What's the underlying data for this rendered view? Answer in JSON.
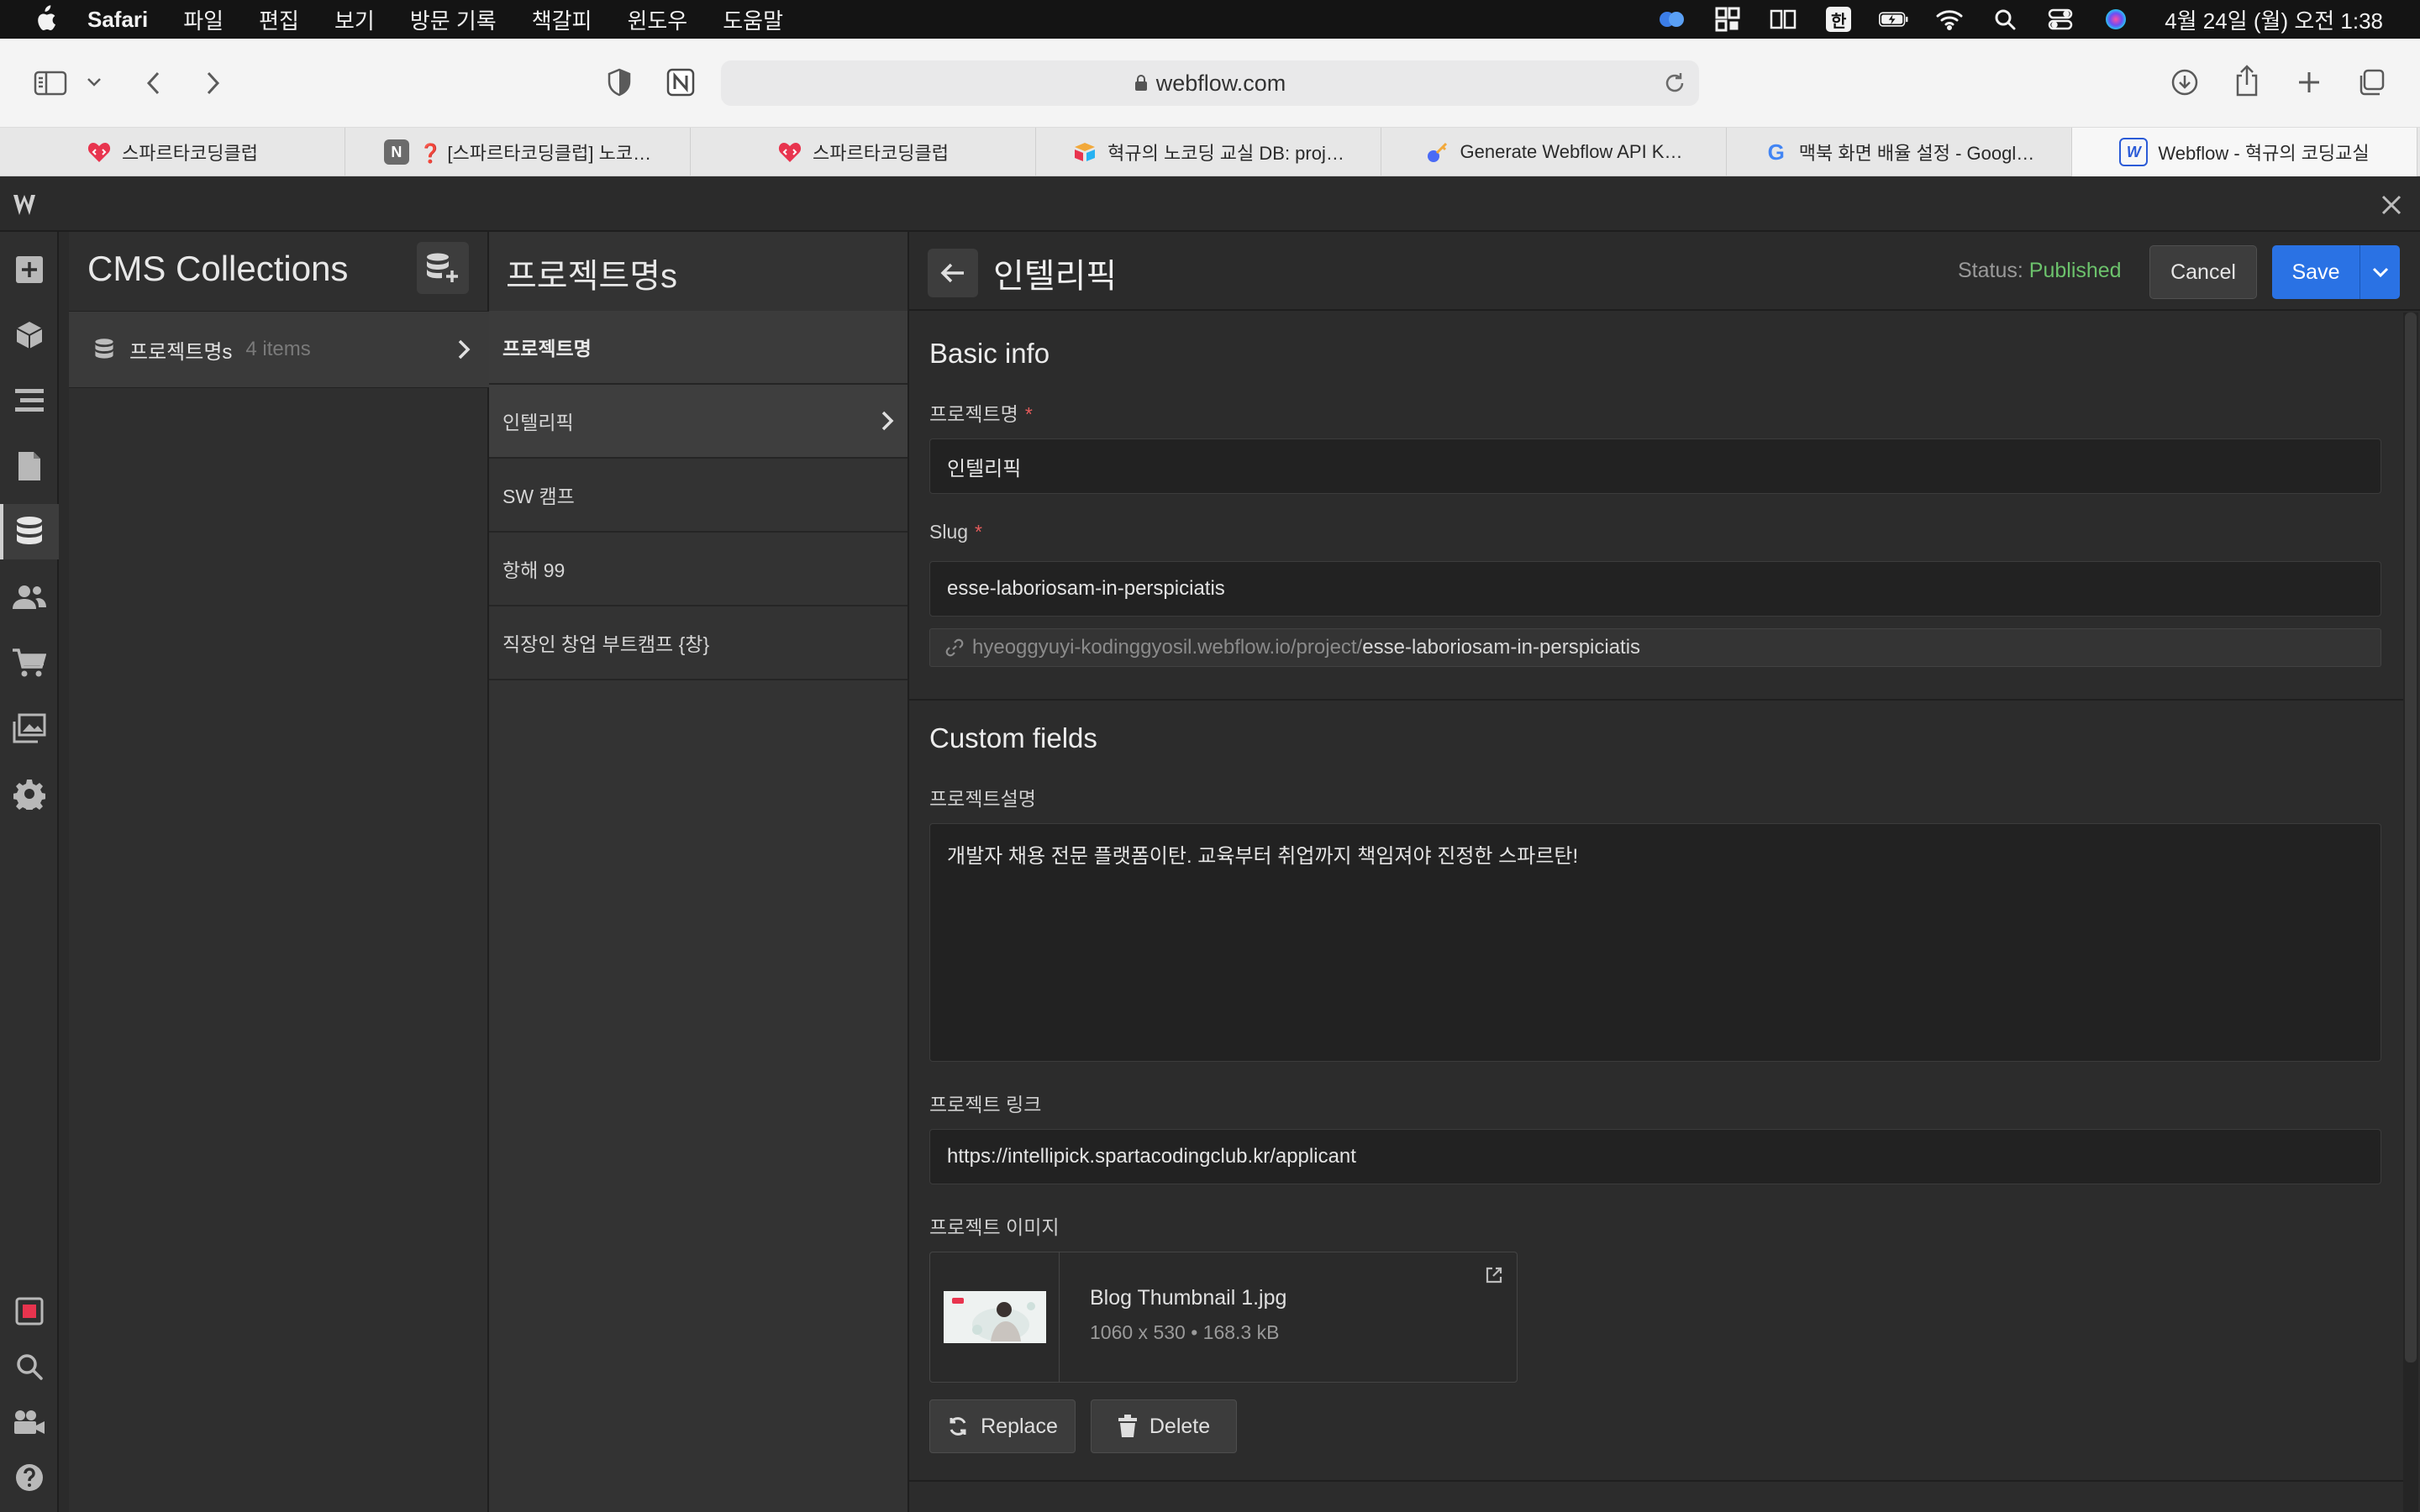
{
  "menubar": {
    "app_name": "Safari",
    "menus": [
      "파일",
      "편집",
      "보기",
      "방문 기록",
      "책갈피",
      "윈도우",
      "도움말"
    ],
    "clock": "4월 24일 (월) 오전 1:38",
    "input_indicator": "한"
  },
  "browser": {
    "address": "webflow.com"
  },
  "tabs": [
    {
      "title": "스파르타코딩클럽",
      "favicon_color": "#e8344e"
    },
    {
      "title": "❓ [스파르타코딩클럽] 노코…",
      "favicon_letter": "N",
      "favicon_color": "#6b6b6b"
    },
    {
      "title": "스파르타코딩클럽",
      "favicon_color": "#e8344e"
    },
    {
      "title": "혁규의 노코딩 교실 DB: proj…",
      "favicon_color": "#f2a93b"
    },
    {
      "title": "Generate Webflow API K…",
      "favicon_color": "#4b6bf5"
    },
    {
      "title": "맥북 화면 배율 설정 - Googl…",
      "favicon_letter": "G",
      "favicon_color": "#4285f4"
    },
    {
      "title": "Webflow - 혁규의 코딩교실",
      "favicon_letter": "W",
      "favicon_color": "#2b5bd7"
    }
  ],
  "collections_panel": {
    "title": "CMS Collections",
    "collection": {
      "name": "프로젝트명s",
      "count": "4 items"
    }
  },
  "items_panel": {
    "title": "프로젝트명s",
    "header": "프로젝트명",
    "items": [
      "인텔리픽",
      "SW 캠프",
      "항해 99",
      "직장인 창업 부트캠프 {창}"
    ]
  },
  "editor": {
    "title": "인텔리픽",
    "status_label": "Status:",
    "status_value": "Published",
    "cancel_label": "Cancel",
    "save_label": "Save",
    "basic_info": {
      "section_title": "Basic info",
      "name_label": "프로젝트명",
      "name_value": "인텔리픽",
      "slug_label": "Slug",
      "slug_value": "esse-laboriosam-in-perspiciatis",
      "url_prefix": "hyeoggyuyi-kodinggyosil.webflow.io/project/",
      "url_slug": "esse-laboriosam-in-perspiciatis"
    },
    "custom_fields": {
      "section_title": "Custom fields",
      "desc_label": "프로젝트설명",
      "desc_value": "개발자 채용 전문 플랫폼이탄. 교육부터 취업까지 책임져야 진정한 스파르탄!",
      "link_label": "프로젝트 링크",
      "link_value": "https://intellipick.spartacodingclub.kr/applicant",
      "image_label": "프로젝트 이미지",
      "image": {
        "file_name": "Blog Thumbnail 1.jpg",
        "meta": "1060 x 530 • 168.3 kB"
      },
      "replace_label": "Replace",
      "delete_label": "Delete"
    }
  },
  "colors": {
    "accent_blue": "#2a72e4",
    "published_green": "#6cc26c",
    "required_red": "#e35b5b"
  }
}
